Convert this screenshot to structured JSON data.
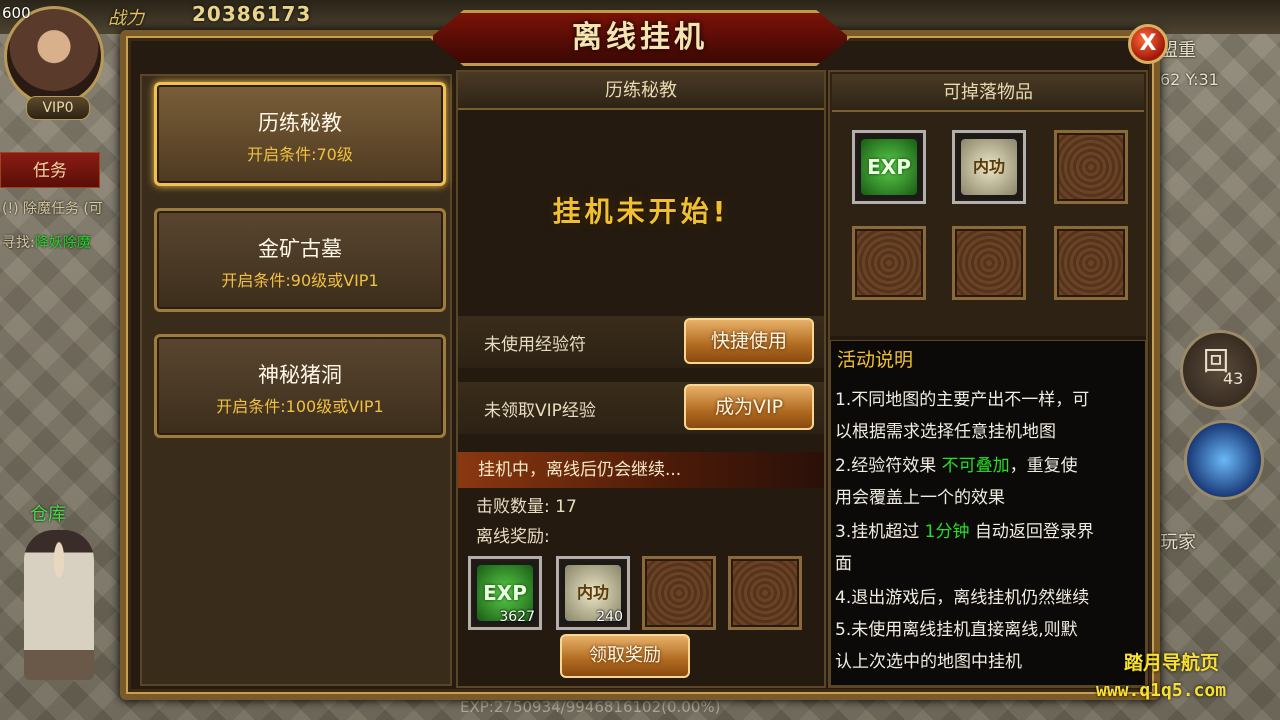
{
  "hud": {
    "level": "600",
    "vip": "VIP0",
    "power_label": "战力",
    "power_value": "20386173",
    "task_tab": "任务",
    "task_line1": "(!) 除魔任务 (可",
    "task_line2_prefix": "寻找:",
    "task_line2_target": "降妖除魔",
    "warehouse": "仓库",
    "right_top": "盟重",
    "right_coord": "62 Y:31",
    "skill_count": "43",
    "skill_glyph": "回",
    "player_label": "玩家",
    "exp_text": "EXP:2750934/9946816102(0.00%)"
  },
  "dialog": {
    "title": "离线挂机",
    "close_label": "X",
    "maps": [
      {
        "name": "历练秘教",
        "condition": "开启条件:70级",
        "selected": true
      },
      {
        "name": "金矿古墓",
        "condition": "开启条件:90级或VIP1",
        "selected": false
      },
      {
        "name": "神秘猪洞",
        "condition": "开启条件:100级或VIP1",
        "selected": false
      }
    ],
    "middle": {
      "header": "历练秘教",
      "status": "挂机未开始!",
      "exp_talisman_label": "未使用经验符",
      "exp_talisman_button": "快捷使用",
      "vip_exp_label": "未领取VIP经验",
      "vip_button": "成为VIP",
      "progress_text": "挂机中，离线后仍会继续...",
      "defeat_label": "击败数量:",
      "defeat_value": "17",
      "reward_label": "离线奖励:",
      "rewards": [
        {
          "icon": "exp-item-icon",
          "text": "EXP",
          "count": "3627"
        },
        {
          "icon": "neigong-item-icon",
          "text": "内功",
          "count": "240"
        },
        {
          "icon": "empty-slot",
          "text": "",
          "count": ""
        },
        {
          "icon": "empty-slot",
          "text": "",
          "count": ""
        }
      ],
      "claim_button": "领取奖励"
    },
    "drops": {
      "header": "可掉落物品",
      "items": [
        {
          "icon": "exp-item-icon",
          "text": "EXP"
        },
        {
          "icon": "neigong-item-icon",
          "text": "内功"
        },
        {
          "icon": "empty-slot",
          "text": ""
        },
        {
          "icon": "empty-slot",
          "text": ""
        },
        {
          "icon": "empty-slot",
          "text": ""
        },
        {
          "icon": "empty-slot",
          "text": ""
        }
      ]
    },
    "description": {
      "title": "活动说明",
      "line1": "1.不同地图的主要产出不一样，可",
      "line2": "以根据需求选择任意挂机地图",
      "line3_a": "2.经验符效果 ",
      "line3_b": "不可叠加",
      "line3_c": "，重复使",
      "line4": "用会覆盖上一个的效果",
      "line5_a": "3.挂机超过 ",
      "line5_b": "1分钟",
      "line5_c": " 自动返回登录界",
      "line6": "面",
      "line7": "4.退出游戏后，离线挂机仍然继续",
      "line8": "5.未使用离线挂机直接离线,则默",
      "line9": "认上次选中的地图中挂机"
    }
  },
  "watermark": {
    "line1": "踏月导航页",
    "line2": "www.q1q5.com"
  }
}
